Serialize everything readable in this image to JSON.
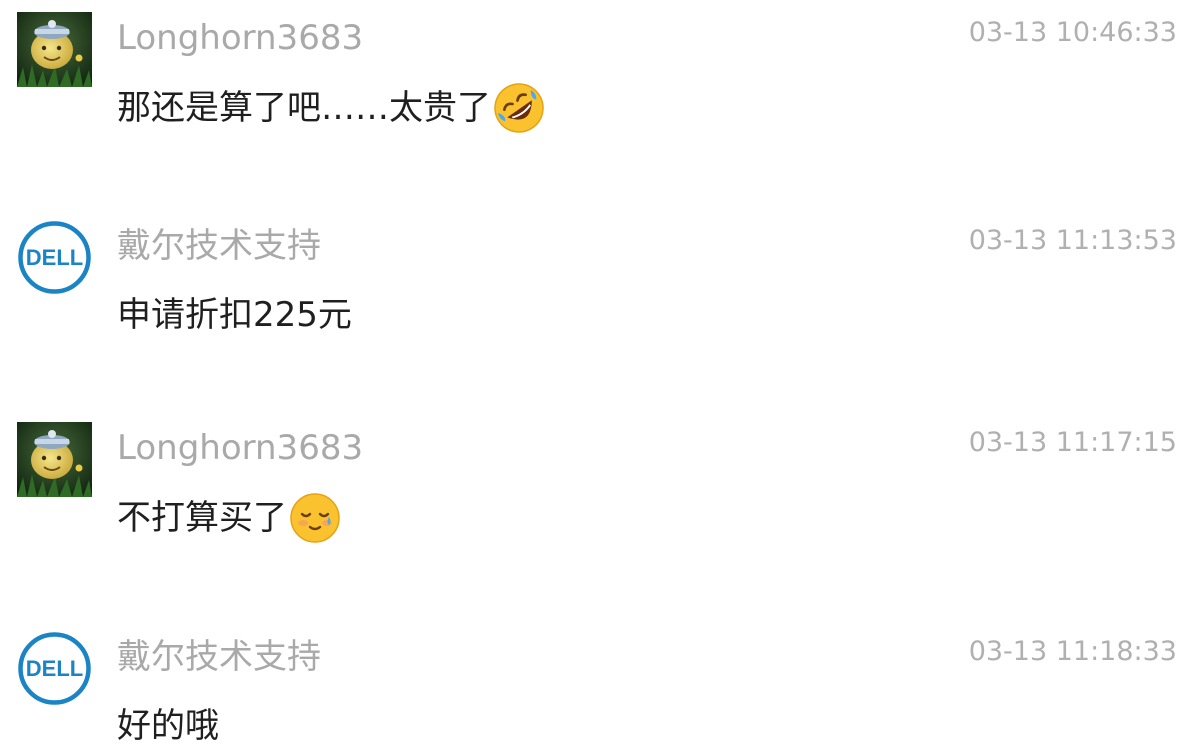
{
  "messages": [
    {
      "avatar": "customer-avatar",
      "sender": "Longhorn3683",
      "time": "03-13 10:46:33",
      "text": "那还是算了吧……太贵了",
      "emoji": "rolling-on-floor-laughing-emoji"
    },
    {
      "avatar": "dell-logo-avatar",
      "avatar_text": "DELL",
      "sender": "戴尔技术支持",
      "time": "03-13 11:13:53",
      "text": "申请折扣225元"
    },
    {
      "avatar": "customer-avatar",
      "sender": "Longhorn3683",
      "time": "03-13 11:17:15",
      "text": "不打算买了",
      "emoji": "smiling-face-with-tear-emoji"
    },
    {
      "avatar": "dell-logo-avatar",
      "avatar_text": "DELL",
      "sender": "戴尔技术支持",
      "time": "03-13 11:18:33",
      "text": "好的哦"
    }
  ],
  "colors": {
    "sender": "#a9a9a9",
    "time": "#b0b0b0",
    "text": "#1f1f1f",
    "dell_blue": "#1b84c4"
  }
}
